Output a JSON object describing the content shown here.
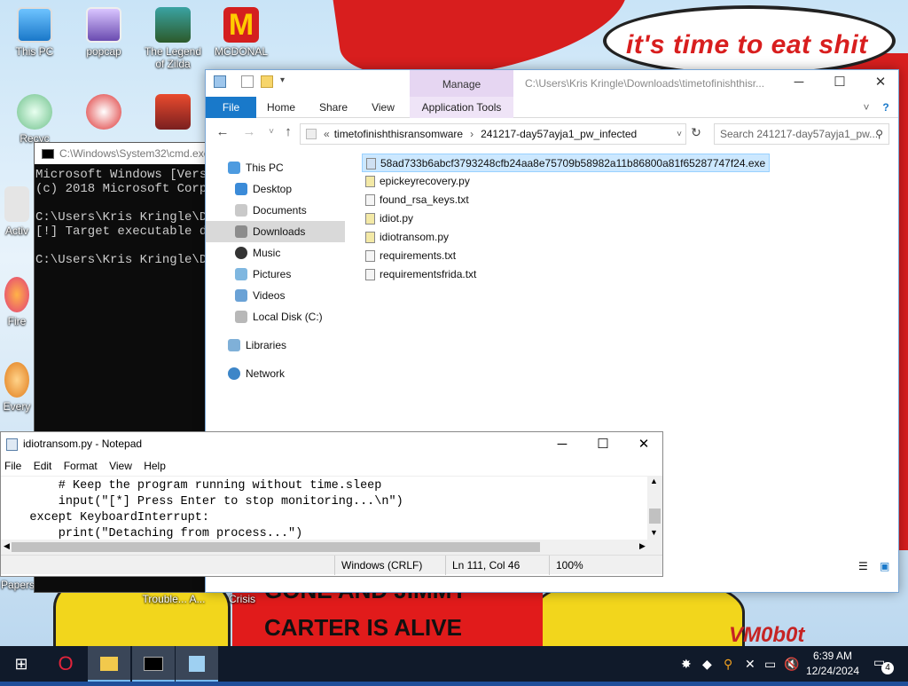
{
  "wallpaper": {
    "top_text": "it's time to eat shit",
    "sign_line1": "GONE AND JIMMY",
    "sign_line2": "CARTER IS ALIVE",
    "signature": "VM0b0t"
  },
  "desktop_icons": [
    {
      "label": "This PC"
    },
    {
      "label": "popcap"
    },
    {
      "label": "The Legend of Zilda"
    },
    {
      "label": "MCDONAL"
    },
    {
      "label": "Recyc"
    },
    {
      "label": "Activ"
    },
    {
      "label": "Fire"
    },
    {
      "label": "Every"
    },
    {
      "label": "Papers"
    },
    {
      "label": "Trouble... A..."
    },
    {
      "label": "Crisis"
    }
  ],
  "cmd": {
    "title": "C:\\Windows\\System32\\cmd.exe",
    "lines": "Microsoft Windows [Versi\n(c) 2018 Microsoft Corpo\n\nC:\\Users\\Kris Kringle\\Do\n[!] Target executable do\n\nC:\\Users\\Kris Kringle\\Do"
  },
  "explorer": {
    "manage_tab": "Manage",
    "title_path": "C:\\Users\\Kris Kringle\\Downloads\\timetofinishthisr...",
    "ribbon_tabs": [
      "File",
      "Home",
      "Share",
      "View",
      "Application Tools"
    ],
    "address": {
      "crumb1": "timetofinishthisransomware",
      "crumb2": "241217-day57ayja1_pw_infected"
    },
    "search_placeholder": "Search 241217-day57ayja1_pw...",
    "nav_items": [
      "This PC",
      "Desktop",
      "Documents",
      "Downloads",
      "Music",
      "Pictures",
      "Videos",
      "Local Disk (C:)",
      "Libraries",
      "Network"
    ],
    "selected_nav": "Downloads",
    "files": [
      "58ad733b6abcf3793248cfb24aa8e75709b58982a11b86800a81f65287747f24.exe",
      "epickeyrecovery.py",
      "found_rsa_keys.txt",
      "idiot.py",
      "idiotransom.py",
      "requirements.txt",
      "requirementsfrida.txt"
    ]
  },
  "notepad": {
    "title": "idiotransom.py - Notepad",
    "menu": [
      "File",
      "Edit",
      "Format",
      "View",
      "Help"
    ],
    "content": "        # Keep the program running without time.sleep\n        input(\"[*] Press Enter to stop monitoring...\\n\")\n    except KeyboardInterrupt:\n        print(\"Detaching from process...\")",
    "status": {
      "line_ending": "Windows (CRLF)",
      "position": "Ln 111, Col 46",
      "zoom": "100%"
    }
  },
  "taskbar": {
    "time": "6:39 AM",
    "date": "12/24/2024",
    "notification_count": "4"
  },
  "colors": {
    "accent": "#1979ca",
    "manage_tab": "#e6d6f2",
    "taskbar": "#101a2a"
  }
}
